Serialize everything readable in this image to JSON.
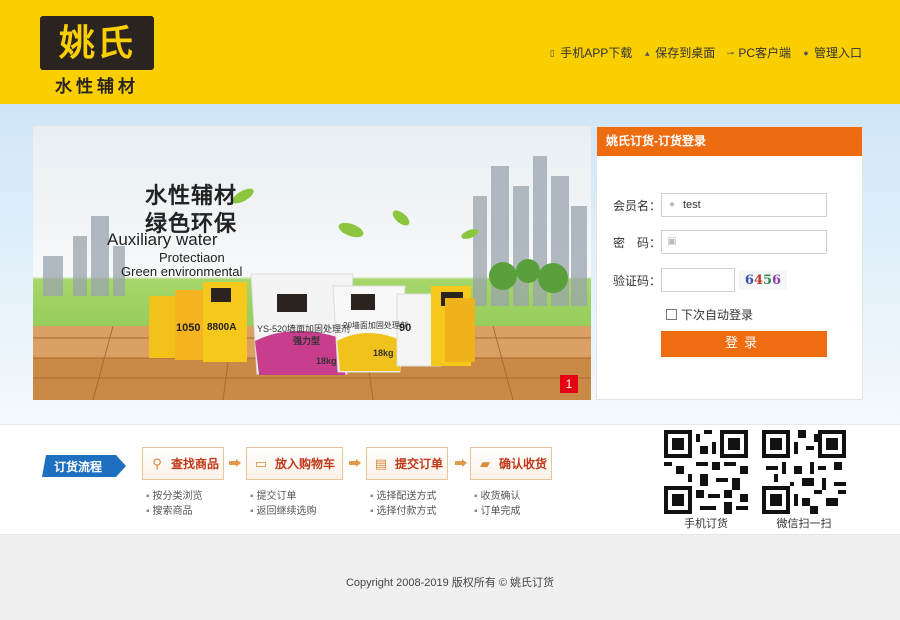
{
  "brand": {
    "logo_mark": "姚氏",
    "logo_sub": "水性辅材"
  },
  "top_links": [
    {
      "label": "手机APP下载",
      "icon": "phone-icon"
    },
    {
      "label": "保存到桌面",
      "icon": "desktop-icon"
    },
    {
      "label": "PC客户端",
      "icon": "key-icon"
    },
    {
      "label": "管理入口",
      "icon": "user-icon"
    }
  ],
  "banner": {
    "title_line1": "水性辅材",
    "title_line2": "绿色环保",
    "en_line1": "Auxiliary water",
    "en_line2": "Protectiaon",
    "en_line3": "Green environmental",
    "product_label1": "YS-520墙面加固处理剂",
    "product_label2": "20墙面加固处理剂",
    "weight_label": "18kg",
    "badge_label": "强力型",
    "left_codes": [
      "1050",
      "8800A",
      "90"
    ],
    "slide_number": "1"
  },
  "login": {
    "title": "姚氏订货-订货登录",
    "username_label": "会员名：",
    "username_value": "test",
    "password_label": "密　码：",
    "captcha_label": "验证码：",
    "captcha_value": "6456",
    "auto_login_label": "下次自动登录",
    "submit_label": "登录"
  },
  "process": {
    "tag": "订货流程",
    "steps": [
      {
        "label": "查找商品",
        "icon": "search-icon",
        "subs": [
          "按分类浏览",
          "搜索商品"
        ]
      },
      {
        "label": "放入购物车",
        "icon": "cart-icon",
        "subs": [
          "提交订单",
          "返回继续选购"
        ]
      },
      {
        "label": "提交订单",
        "icon": "document-icon",
        "subs": [
          "选择配送方式",
          "选择付款方式"
        ]
      },
      {
        "label": "确认收货",
        "icon": "truck-icon",
        "subs": [
          "收货确认",
          "订单完成"
        ]
      }
    ],
    "qr_codes": [
      {
        "label": "手机订货"
      },
      {
        "label": "微信扫一扫"
      }
    ]
  },
  "footer": {
    "copyright": "Copyright 2008-2019 版权所有 © 姚氏订货"
  },
  "colors": {
    "header_yellow": "#f9cf00",
    "login_orange": "#ee6c10",
    "flow_blue": "#1f6fc0",
    "step_red": "#c0391b"
  }
}
